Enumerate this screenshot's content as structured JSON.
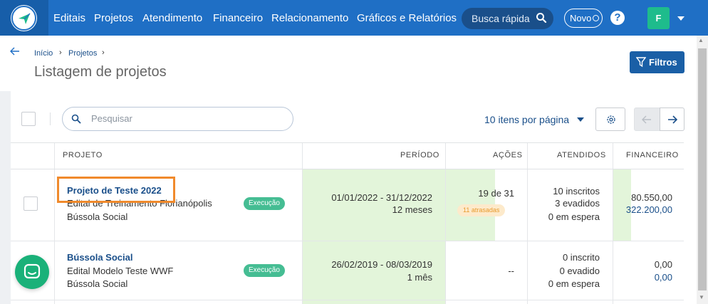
{
  "colors": {
    "nav_bg": "#1f6fc5",
    "accent_green": "#45bd93",
    "green_cell": "#e3f5da",
    "highlight": "#f08a2c",
    "link": "#1a4f8a"
  },
  "nav": {
    "logo_icon": "paper-plane-logo-icon",
    "items": [
      "Editais",
      "Projetos",
      "Atendimento",
      "Financeiro",
      "Relacionamento",
      "Gráficos e Relatórios"
    ],
    "search_label": "Busca rápida",
    "new_label": "Novo",
    "help_label": "?",
    "avatar_letter": "F"
  },
  "breadcrumb": {
    "items": [
      "Início",
      "Projetos"
    ]
  },
  "page": {
    "title": "Listagem de projetos",
    "filters_label": "Filtros"
  },
  "toolbar": {
    "search_placeholder": "Pesquisar",
    "per_page_label": "10 itens por página"
  },
  "table": {
    "headers": {
      "project": "PROJETO",
      "period": "PERÍODO",
      "actions": "AÇÕES",
      "served": "ATENDIDOS",
      "financial": "FINANCEIRO"
    },
    "rows": [
      {
        "title": "Projeto de Teste 2022",
        "edital": "Edital de Treinamento Florianópolis",
        "org": "Bússola Social",
        "status": "Execução",
        "period": "01/01/2022 - 31/12/2022",
        "duration": "12 meses",
        "actions": "19 de 31",
        "late_badge": "11 atrasadas",
        "served": [
          "10 inscritos",
          "3 evadidos",
          "0 em espera"
        ],
        "financial": [
          "80.550,00",
          "322.200,00"
        ]
      },
      {
        "title": "Bússola Social",
        "edital": "Edital Modelo Teste WWF",
        "org": "Bússola Social",
        "status": "Execução",
        "period": "26/02/2019 - 08/03/2019",
        "duration": "1 mês",
        "actions": "--",
        "served": [
          "0 inscrito",
          "0 evadido",
          "0 em espera"
        ],
        "financial": [
          "0,00",
          "0,00"
        ]
      }
    ]
  }
}
